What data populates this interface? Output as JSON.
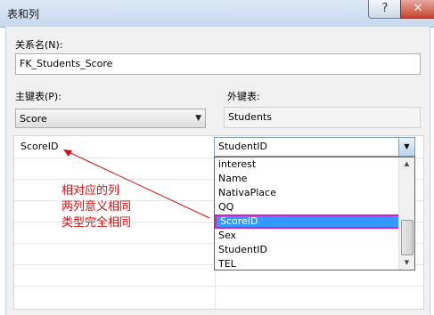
{
  "window": {
    "title": "表和列",
    "help_glyph": "?",
    "close_glyph": "✕"
  },
  "form": {
    "relation_name_label": "关系名(N):",
    "relation_name_value": "FK_Students_Score",
    "primary_table_label": "主键表(P):",
    "primary_table_value": "Score",
    "foreign_table_label": "外键表:",
    "foreign_table_value": "Students"
  },
  "columns": {
    "primary_column": "ScoreID",
    "foreign_column_value": "StudentID",
    "dropdown_options": [
      "interest",
      "Name",
      "NativaPlace",
      "QQ",
      "ScoreID",
      "Sex",
      "StudentID",
      "TEL"
    ],
    "selected_option": "ScoreID"
  },
  "annotation": {
    "lines": [
      "相对应的列",
      "两列意义相同",
      "类型完全相同"
    ],
    "color": "#d01010"
  }
}
